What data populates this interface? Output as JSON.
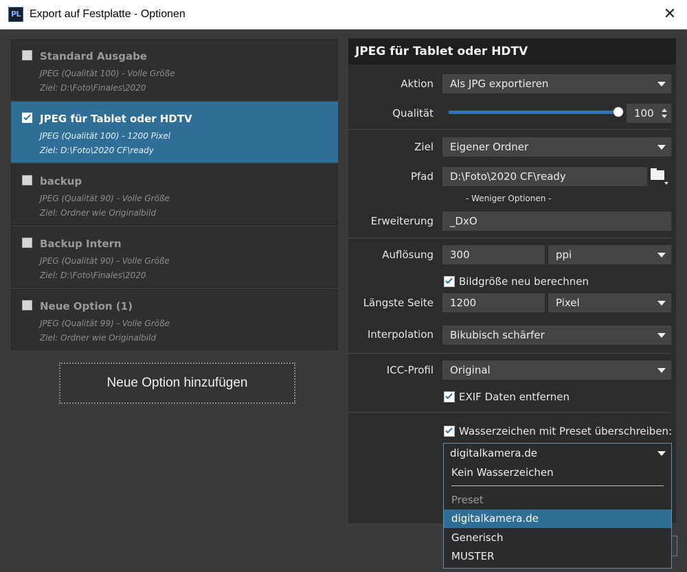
{
  "window": {
    "icon_text": "PL",
    "title": "Export auf Festplatte - Optionen",
    "close_glyph": "✕"
  },
  "options": [
    {
      "name": "Standard Ausgabe",
      "line1": "JPEG (Qualität 100) - Volle Größe",
      "line2": "Ziel: D:\\Foto\\Finales\\2020",
      "checked": false
    },
    {
      "name": "JPEG für Tablet oder HDTV",
      "line1": "JPEG (Qualität 100) - 1200 Pixel",
      "line2": "Ziel: D:\\Foto\\2020 CF\\ready",
      "checked": true
    },
    {
      "name": "backup",
      "line1": "JPEG (Qualität 90) - Volle Größe",
      "line2": "Ziel: Ordner wie Originalbild",
      "checked": false
    },
    {
      "name": "Backup Intern",
      "line1": "JPEG (Qualität 90) - Volle Größe",
      "line2": "Ziel: D:\\Foto\\Finales\\2020",
      "checked": false
    },
    {
      "name": "Neue Option (1)",
      "line1": "JPEG (Qualität 99) - Volle Größe",
      "line2": "Ziel: Ordner wie Originalbild",
      "checked": false
    }
  ],
  "add_button": "Neue Option hinzufügen",
  "panel": {
    "title": "JPEG für Tablet oder HDTV",
    "aktion": {
      "label": "Aktion",
      "value": "Als JPG exportieren"
    },
    "qualitaet": {
      "label": "Qualität",
      "value": "100",
      "level_percent": 100
    },
    "ziel": {
      "label": "Ziel",
      "value": "Eigener Ordner"
    },
    "pfad": {
      "label": "Pfad",
      "value": "D:\\Foto\\2020 CF\\ready"
    },
    "less_options": "- Weniger Optionen -",
    "erweiterung": {
      "label": "Erweiterung",
      "value": "_DxO"
    },
    "aufloesung": {
      "label": "Auflösung",
      "value": "300",
      "unit": "ppi"
    },
    "recalc": {
      "label": "Bildgröße neu berechnen",
      "checked": true
    },
    "laengste_seite": {
      "label": "Längste Seite",
      "value": "1200",
      "unit": "Pixel"
    },
    "interpolation": {
      "label": "Interpolation",
      "value": "Bikubisch schärfer"
    },
    "icc": {
      "label": "ICC-Profil",
      "value": "Original"
    },
    "exif": {
      "label": "EXIF Daten entfernen",
      "checked": true
    },
    "watermark": {
      "label": "Wasserzeichen mit Preset überschreiben:",
      "checked": true
    }
  },
  "dropdown": {
    "selected": "digitalkamera.de",
    "items": [
      {
        "label": "Kein Wasserzeichen",
        "kind": "item"
      },
      {
        "label": "Preset",
        "kind": "group"
      },
      {
        "label": "digitalkamera.de",
        "kind": "highlight"
      },
      {
        "label": "Generisch",
        "kind": "item"
      },
      {
        "label": "MUSTER",
        "kind": "item"
      }
    ]
  }
}
